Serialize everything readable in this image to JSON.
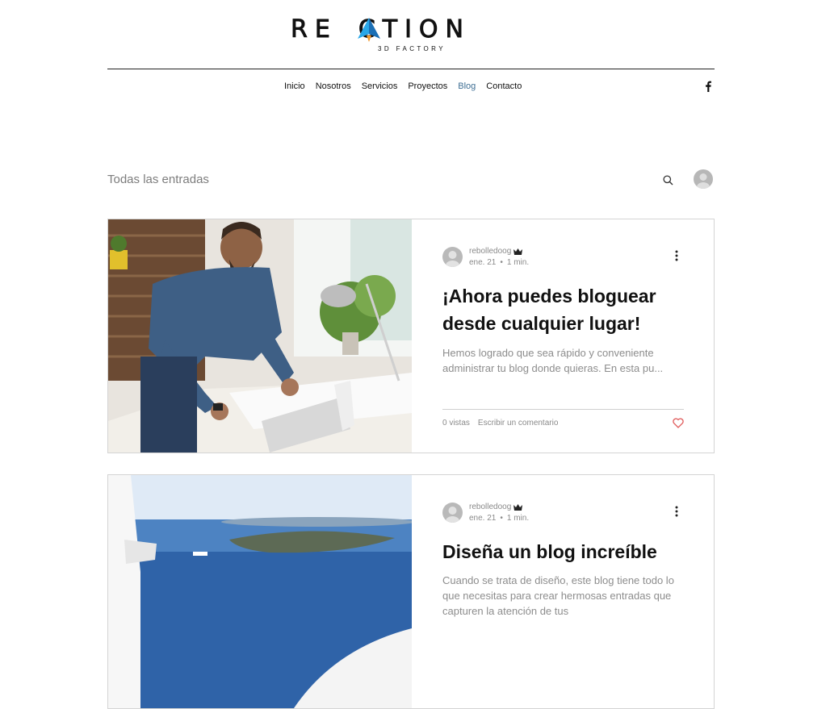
{
  "header": {
    "logo_text_left": "RE",
    "logo_text_right": "CTION",
    "logo_sub": "3D FACTORY",
    "nav": [
      {
        "label": "Inicio",
        "active": false
      },
      {
        "label": "Nosotros",
        "active": false
      },
      {
        "label": "Servicios",
        "active": false
      },
      {
        "label": "Proyectos",
        "active": false
      },
      {
        "label": "Blog",
        "active": true
      },
      {
        "label": "Contacto",
        "active": false
      }
    ],
    "social_icon": "facebook-icon"
  },
  "blog": {
    "filter_label": "Todas las entradas",
    "search_icon": "search-icon",
    "avatar_icon": "user-avatar-icon"
  },
  "posts": [
    {
      "author": "rebolledoog",
      "date": "ene. 21",
      "read_time": "1 min.",
      "title": "¡Ahora puedes bloguear desde cualquier lugar!",
      "excerpt": "Hemos logrado que sea rápido y conveniente administrar tu blog donde quieras. En esta pu...",
      "views": "0 vistas",
      "comment_label": "Escribir un comentario",
      "image": "man-working-at-desk-photo"
    },
    {
      "author": "rebolledoog",
      "date": "ene. 21",
      "read_time": "1 min.",
      "title": "Diseña un blog increíble",
      "excerpt": "Cuando se trata de diseño, este blog tiene todo lo que necesitas para crear hermosas entradas que capturen la atención de tus",
      "image": "santorini-sea-view-photo"
    }
  ],
  "colors": {
    "accent": "#3f6f94",
    "heart": "#e05b5b",
    "logo_blue": "#2aa7e8",
    "logo_orange": "#f29a2e"
  }
}
